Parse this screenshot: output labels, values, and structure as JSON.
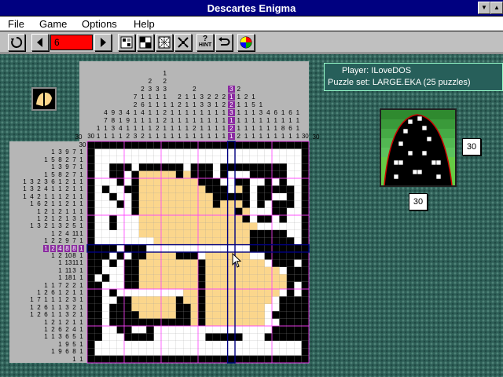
{
  "window": {
    "title": "Descartes Enigma",
    "title_color": "#000080"
  },
  "menu": {
    "items": [
      {
        "label": "File"
      },
      {
        "label": "Game"
      },
      {
        "label": "Options"
      },
      {
        "label": "Help"
      }
    ]
  },
  "toolbar": {
    "puzzle_number": "6",
    "hint_label": "HINT",
    "icons": [
      "restart-icon",
      "prev-puzzle-icon",
      "next-puzzle-icon",
      "grid-view-icon",
      "checker-icon",
      "pattern-icon",
      "zoom-icon",
      "hint-icon",
      "undo-icon",
      "color-palette-icon"
    ]
  },
  "info": {
    "player_line": "Player: ILoveDOS",
    "puzzle_set_line": "Puzzle set: LARGE.EKA (25 puzzles)"
  },
  "preview": {
    "width_label": "30",
    "height_label": "30"
  },
  "puzzle": {
    "size": 30,
    "corner_col": "30",
    "corner_row": "30",
    "cursor_row_index": 14,
    "cursor_col_index": 19,
    "colors": {
      "filled": "#000000",
      "highlight": "#fbd68c",
      "blank": "#ffffff",
      "cursor_line": "#000080",
      "guide": "#ff40ff"
    },
    "col_clues": [
      [
        "30"
      ],
      [
        "1",
        "1"
      ],
      [
        "4",
        "7",
        "1",
        "1"
      ],
      [
        "9",
        "8",
        "3",
        "1"
      ],
      [
        "3",
        "1",
        "4",
        "1"
      ],
      [
        "4",
        "9",
        "1",
        "2"
      ],
      [
        "7",
        "2",
        "1",
        "1",
        "1",
        "3"
      ],
      [
        "2",
        "1",
        "6",
        "4",
        "1",
        "1",
        "2"
      ],
      [
        "2",
        "3",
        "1",
        "1",
        "1",
        "1",
        "1",
        "1"
      ],
      [
        "3",
        "1",
        "1",
        "1",
        "1",
        "2",
        "1"
      ],
      [
        "1",
        "2",
        "3",
        "1",
        "1",
        "2",
        "2",
        "1",
        "1"
      ],
      [
        "1",
        "1",
        "1",
        "1",
        "1"
      ],
      [
        "2",
        "2",
        "1",
        "1",
        "1",
        "1"
      ],
      [
        "1",
        "1",
        "1",
        "1",
        "1",
        "1"
      ],
      [
        "2",
        "1",
        "1",
        "1",
        "1",
        "2",
        "1"
      ],
      [
        "3",
        "3",
        "1",
        "1",
        "1",
        "1"
      ],
      [
        "2",
        "3",
        "1",
        "1",
        "1",
        "1"
      ],
      [
        "2",
        "1",
        "1",
        "1",
        "1",
        "1"
      ],
      [
        "2",
        "2",
        "1",
        "1",
        "1",
        "1"
      ],
      [
        "3",
        "1",
        "2",
        "3",
        "1",
        "2",
        "1"
      ],
      [
        "2",
        "1",
        "1",
        "1",
        "1",
        "1",
        "2"
      ],
      [
        "2",
        "1",
        "1",
        "1",
        "1",
        "1"
      ],
      [
        "1",
        "5",
        "1",
        "1",
        "1",
        "1"
      ],
      [
        "1",
        "3",
        "1",
        "1",
        "1"
      ],
      [
        "4",
        "1",
        "1",
        "1"
      ],
      [
        "6",
        "1",
        "1",
        "1"
      ],
      [
        "1",
        "1",
        "8",
        "1"
      ],
      [
        "6",
        "1",
        "6",
        "1"
      ],
      [
        "1",
        "1",
        "1",
        "1"
      ],
      [
        "30"
      ]
    ],
    "row_clues": [
      [
        "30"
      ],
      [
        "1",
        "3",
        "9",
        "7",
        "1"
      ],
      [
        "1",
        "5",
        "8",
        "2",
        "7",
        "1"
      ],
      [
        "1",
        "3",
        "9",
        "7",
        "1"
      ],
      [
        "1",
        "5",
        "8",
        "2",
        "7",
        "1"
      ],
      [
        "1",
        "3",
        "2",
        "3",
        "6",
        "1",
        "2",
        "1",
        "1"
      ],
      [
        "1",
        "3",
        "2",
        "4",
        "1",
        "1",
        "2",
        "1",
        "1"
      ],
      [
        "1",
        "4",
        "2",
        "1",
        "1",
        "1",
        "2",
        "1",
        "1"
      ],
      [
        "1",
        "6",
        "2",
        "1",
        "1",
        "2",
        "1",
        "1"
      ],
      [
        "1",
        "2",
        "1",
        "2",
        "1",
        "1",
        "1"
      ],
      [
        "1",
        "2",
        "1",
        "2",
        "1",
        "3",
        "1"
      ],
      [
        "1",
        "3",
        "2",
        "1",
        "3",
        "2",
        "5",
        "1"
      ],
      [
        "1",
        "2",
        "4",
        "11",
        "1"
      ],
      [
        "1",
        "2",
        "2",
        "9",
        "7",
        "1"
      ],
      [
        "1",
        "2",
        "4",
        "8",
        "8",
        "1"
      ],
      [
        "1",
        "2",
        "10",
        "8",
        "1"
      ],
      [
        "1",
        "13",
        "11",
        "1"
      ],
      [
        "1",
        "11",
        "3",
        "1"
      ],
      [
        "1",
        "18",
        "1",
        "1"
      ],
      [
        "1",
        "1",
        "7",
        "2",
        "2",
        "1"
      ],
      [
        "1",
        "2",
        "6",
        "1",
        "2",
        "1",
        "1"
      ],
      [
        "1",
        "7",
        "1",
        "1",
        "1",
        "2",
        "3",
        "1"
      ],
      [
        "1",
        "2",
        "6",
        "1",
        "1",
        "3",
        "2",
        "1"
      ],
      [
        "1",
        "2",
        "6",
        "1",
        "1",
        "3",
        "2",
        "1"
      ],
      [
        "1",
        "2",
        "1",
        "2",
        "1",
        "1"
      ],
      [
        "1",
        "2",
        "6",
        "2",
        "4",
        "1"
      ],
      [
        "1",
        "1",
        "3",
        "6",
        "5",
        "1"
      ],
      [
        "1",
        "9",
        "5",
        "1"
      ],
      [
        "1",
        "9",
        "6",
        "8",
        "1"
      ],
      [
        "1",
        "1"
      ]
    ],
    "rows": [
      "222222222222222222222222222222",
      "200000000000000000000000000002",
      "200000000000000000000000000002",
      "200222022222202220222222222002",
      "200220211111212220200022222002",
      "200020211111111222002200202002",
      "202002211111111122201202222202",
      "200200211111111112222202200202",
      "200020211111111112111202022202",
      "200000211111111111112100022002",
      "200200011111111111111202202002",
      "200200011111111111111110000002",
      "200000011111111111111122222002",
      "200000000111111111111122222202",
      "222202220000000000000022222222",
      "222020221111222011111100222222",
      "220202211111111211111111022202",
      "220002211111111211111111110222",
      "202002211111111211111111111222",
      "220002211111111211111111111202",
      "220200000000011211111111110202",
      "220022111111211211111111102222",
      "220222111111221211111111002222",
      "220222211111221211111111022222",
      "220222222222221211111111002222",
      "220022002000000000000000022222",
      "220002222000000022222000222222",
      "200000000000000000000000000002",
      "200000000000000000000000000002",
      "222222222222222222222222222222"
    ]
  }
}
